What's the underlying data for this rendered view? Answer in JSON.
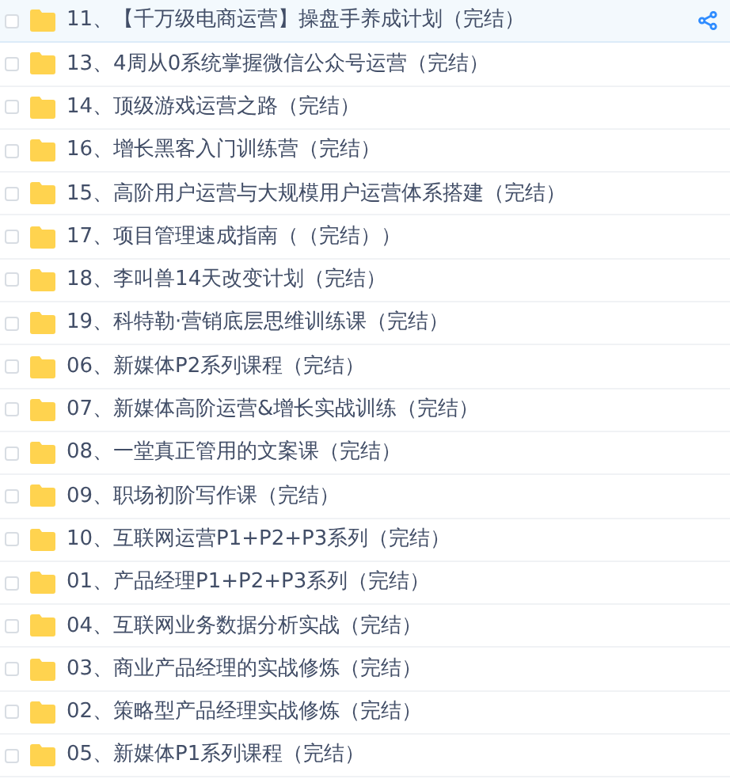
{
  "files": [
    {
      "name": "11、【千万级电商运营】操盘手养成计划（完结）",
      "checked": false,
      "hovered": true
    },
    {
      "name": "13、4周从0系统掌握微信公众号运营（完结）",
      "checked": false,
      "hovered": false
    },
    {
      "name": "14、顶级游戏运营之路（完结）",
      "checked": false,
      "hovered": false
    },
    {
      "name": "16、增长黑客入门训练营（完结）",
      "checked": false,
      "hovered": false
    },
    {
      "name": "15、高阶用户运营与大规模用户运营体系搭建（完结）",
      "checked": false,
      "hovered": false
    },
    {
      "name": "17、项目管理速成指南（（完结））",
      "checked": false,
      "hovered": false
    },
    {
      "name": "18、李叫兽14天改变计划（完结）",
      "checked": false,
      "hovered": false
    },
    {
      "name": "19、科特勒·营销底层思维训练课（完结）",
      "checked": false,
      "hovered": false
    },
    {
      "name": "06、新媒体P2系列课程（完结）",
      "checked": false,
      "hovered": false
    },
    {
      "name": "07、新媒体高阶运营&增长实战训练（完结）",
      "checked": false,
      "hovered": false
    },
    {
      "name": "08、一堂真正管用的文案课（完结）",
      "checked": false,
      "hovered": false
    },
    {
      "name": "09、职场初阶写作课（完结）",
      "checked": false,
      "hovered": false
    },
    {
      "name": "10、互联网运营P1+P2+P3系列（完结）",
      "checked": false,
      "hovered": false
    },
    {
      "name": "01、产品经理P1+P2+P3系列（完结）",
      "checked": false,
      "hovered": false
    },
    {
      "name": "04、互联网业务数据分析实战（完结）",
      "checked": false,
      "hovered": false
    },
    {
      "name": "03、商业产品经理的实战修炼（完结）",
      "checked": false,
      "hovered": false
    },
    {
      "name": "02、策略型产品经理实战修炼（完结）",
      "checked": false,
      "hovered": false
    },
    {
      "name": "05、新媒体P1系列课程（完结）",
      "checked": false,
      "hovered": false
    }
  ]
}
